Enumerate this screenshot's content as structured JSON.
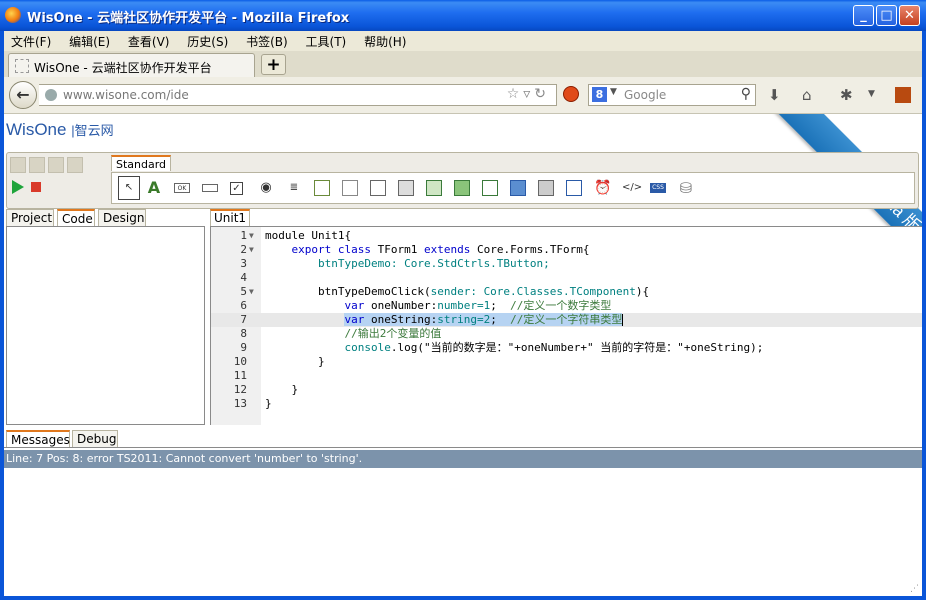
{
  "window": {
    "title": "WisOne - 云端社区协作开发平台 - Mozilla Firefox",
    "controls": {
      "minimize": "_",
      "maximize": "□",
      "close": "✕"
    }
  },
  "menu": [
    "文件(F)",
    "编辑(E)",
    "查看(V)",
    "历史(S)",
    "书签(B)",
    "工具(T)",
    "帮助(H)"
  ],
  "tabs": [
    {
      "label": "WisOne - 云端社区协作开发平台"
    }
  ],
  "new_tab_label": "+",
  "nav": {
    "url": "www.wisone.com/ide",
    "search_placeholder": "Google",
    "search_engine_letter": "8"
  },
  "page": {
    "logo": "WisOne",
    "logo_cn": "|智云网",
    "ribbon": "Pre-Alpha 版本",
    "toolbox_tab": "Standard",
    "tool_icons": [
      "pointer-icon",
      "label-icon",
      "button-icon",
      "textbox-icon",
      "checkbox-icon",
      "radio-icon",
      "memo-icon",
      "listbox-icon",
      "combobox-icon",
      "panel-icon",
      "groupbox-icon",
      "grid-icon",
      "image-icon",
      "frame-icon",
      "window-icon",
      "tabs-icon",
      "listview-icon",
      "timer-icon",
      "html-icon",
      "css-icon",
      "database-icon"
    ],
    "left_tabs": [
      "Project",
      "Code",
      "Design"
    ],
    "left_active_tab": "Code",
    "editor_tab": "Unit1",
    "bottom_tabs": [
      "Messages",
      "Debug"
    ],
    "bottom_active_tab": "Messages",
    "error_message": "Line: 7 Pos: 8: error TS2011: Cannot convert 'number' to 'string'.",
    "code_lines": [
      {
        "n": "1",
        "fold": "▼",
        "text": "module Unit1{"
      },
      {
        "n": "2",
        "fold": "▼",
        "text": "    export class TForm1 extends Core.Forms.TForm{"
      },
      {
        "n": "3",
        "fold": "",
        "text": "        btnTypeDemo: Core.StdCtrls.TButton;"
      },
      {
        "n": "4",
        "fold": "",
        "text": ""
      },
      {
        "n": "5",
        "fold": "▼",
        "text": "        btnTypeDemoClick(sender: Core.Classes.TComponent){"
      },
      {
        "n": "6",
        "fold": "",
        "text": "            var oneNumber:number=1;  //定义一个数字类型"
      },
      {
        "n": "7",
        "fold": "",
        "text": "            var oneString:string=2;  //定义一个字符串类型"
      },
      {
        "n": "8",
        "fold": "",
        "text": "            //输出2个变量的值"
      },
      {
        "n": "9",
        "fold": "",
        "text": "            console.log(\"当前的数字是：\"+oneNumber+\" 当前的字符是：\"+oneString);"
      },
      {
        "n": "10",
        "fold": "",
        "text": "        }"
      },
      {
        "n": "11",
        "fold": "",
        "text": ""
      },
      {
        "n": "12",
        "fold": "",
        "text": "    }"
      },
      {
        "n": "13",
        "fold": "",
        "text": "}"
      }
    ]
  }
}
